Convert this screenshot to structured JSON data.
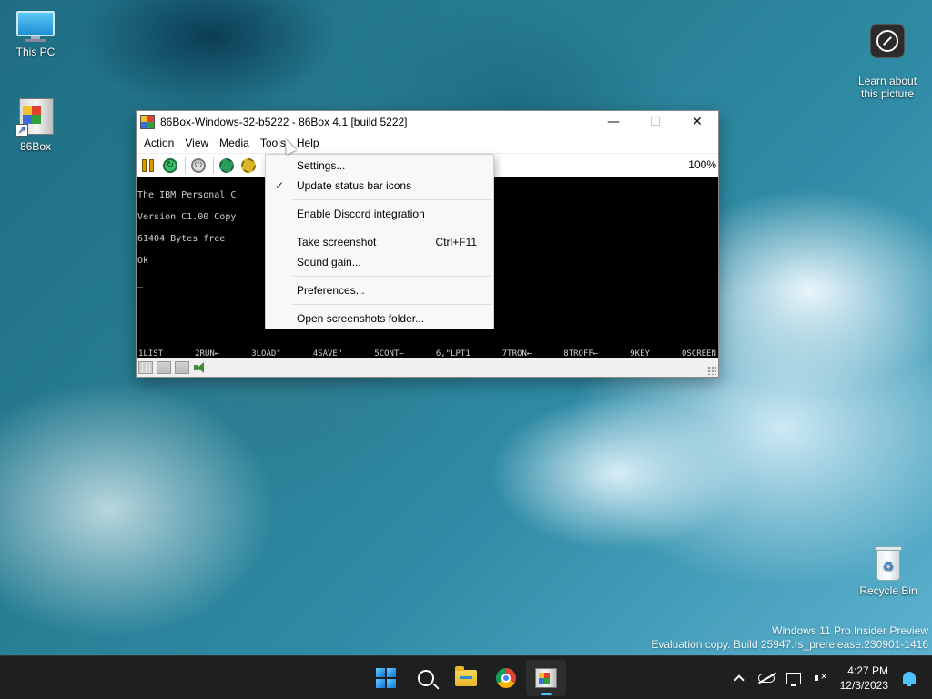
{
  "desktop": {
    "icons": [
      {
        "label": "This PC"
      },
      {
        "label": "86Box"
      },
      {
        "label": "Learn about\nthis picture"
      },
      {
        "label": "Recycle Bin"
      }
    ]
  },
  "window": {
    "title": "86Box-Windows-32-b5222 - 86Box 4.1 [build 5222]",
    "minimize": "—",
    "maximize": "☐",
    "close": "✕",
    "menu": [
      "Action",
      "View",
      "Media",
      "Tools",
      "Help"
    ],
    "zoom": "100%",
    "screen_lines": [
      "The IBM Personal C",
      "Version C1.00 Copy",
      "61404 Bytes free",
      "Ok",
      "_"
    ],
    "fkeys": [
      "1LIST",
      "2RUN←",
      "3LOAD\"",
      "4SAVE\"",
      "5CONT←",
      "6,\"LPT1",
      "7TRON←",
      "8TROFF←",
      "9KEY",
      "0SCREEN"
    ]
  },
  "tools_menu": {
    "items": [
      {
        "label": "Settings...",
        "shortcut": "",
        "checked": false
      },
      {
        "label": "Update status bar icons",
        "shortcut": "",
        "checked": true
      },
      {
        "label": "Enable Discord integration",
        "shortcut": "",
        "checked": false
      },
      {
        "label": "Take screenshot",
        "shortcut": "Ctrl+F11",
        "checked": false
      },
      {
        "label": "Sound gain...",
        "shortcut": "",
        "checked": false
      },
      {
        "label": "Preferences...",
        "shortcut": "",
        "checked": false
      },
      {
        "label": "Open screenshots folder...",
        "shortcut": "",
        "checked": false
      }
    ],
    "check_mark": "✓"
  },
  "watermark": {
    "line1": "Windows 11 Pro Insider Preview",
    "line2": "Evaluation copy. Build 25947.rs_prerelease.230901-1416"
  },
  "taskbar": {
    "time": "4:27 PM",
    "date": "12/3/2023"
  }
}
